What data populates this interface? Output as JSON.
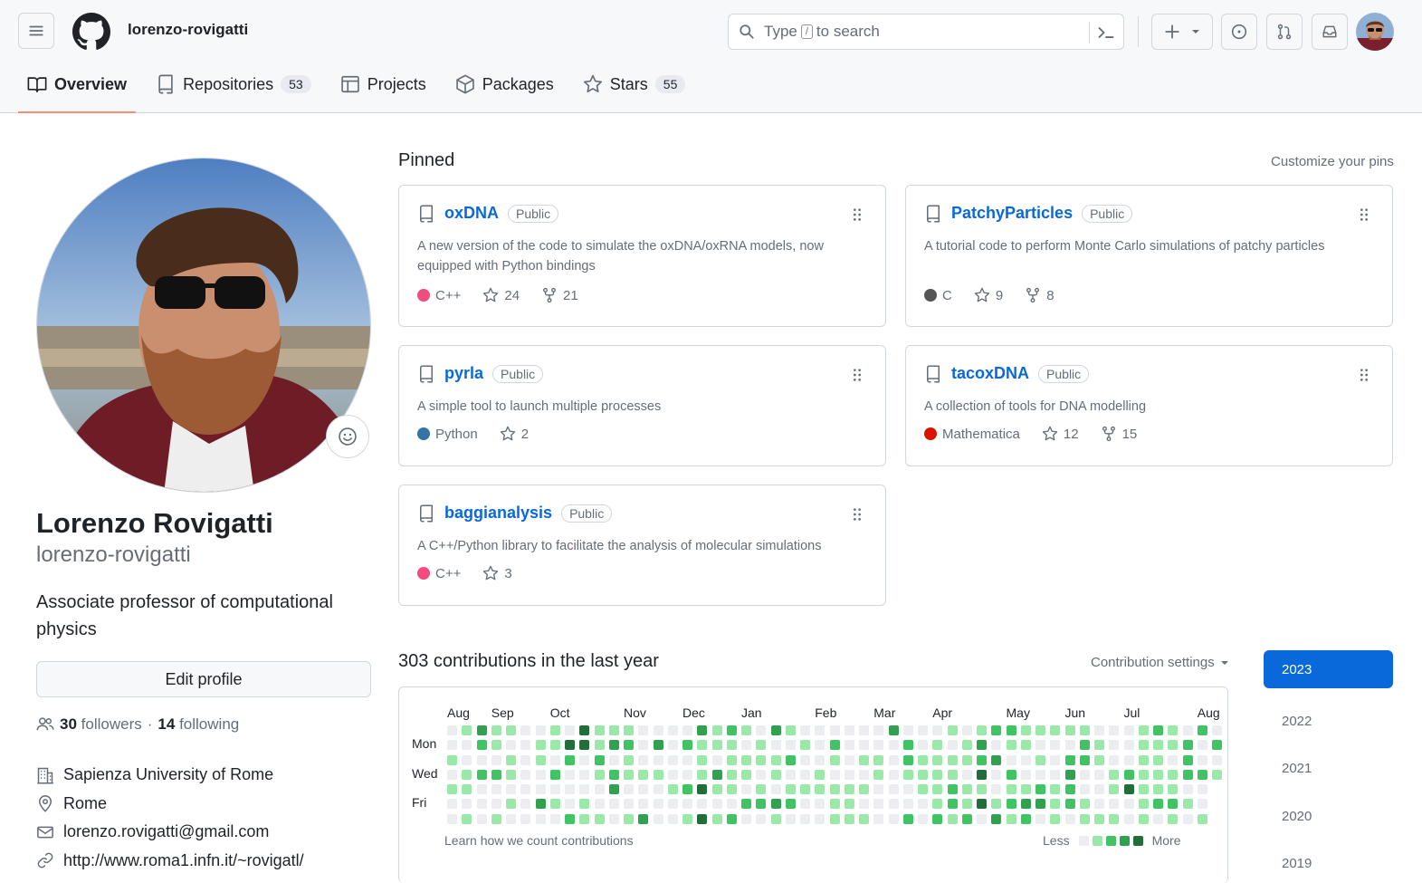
{
  "header": {
    "username": "lorenzo-rovigatti",
    "search_type": "Type",
    "search_key": "/",
    "search_rest": "to search"
  },
  "tabs": [
    {
      "label": "Overview",
      "icon": "book-icon"
    },
    {
      "label": "Repositories",
      "count": "53",
      "icon": "repo-icon"
    },
    {
      "label": "Projects",
      "icon": "table-icon"
    },
    {
      "label": "Packages",
      "icon": "package-icon"
    },
    {
      "label": "Stars",
      "count": "55",
      "icon": "star-icon"
    }
  ],
  "profile": {
    "name": "Lorenzo Rovigatti",
    "login": "lorenzo-rovigatti",
    "bio": "Associate professor of computational physics",
    "edit_label": "Edit profile",
    "followers_count": "30",
    "followers_label": "followers",
    "sep": "·",
    "following_count": "14",
    "following_label": "following",
    "organization": "Sapienza University of Rome",
    "location": "Rome",
    "email": "lorenzo.rovigatti@gmail.com",
    "website": "http://www.roma1.infn.it/~rovigatl/"
  },
  "pinned": {
    "title": "Pinned",
    "customize": "Customize your pins",
    "repos": [
      {
        "name": "oxDNA",
        "visibility": "Public",
        "description": "A new version of the code to simulate the oxDNA/oxRNA models, now equipped with Python bindings",
        "language": "C++",
        "lang_color": "#f34b7d",
        "stars": "24",
        "forks": "21"
      },
      {
        "name": "PatchyParticles",
        "visibility": "Public",
        "description": "A tutorial code to perform Monte Carlo simulations of patchy particles",
        "language": "C",
        "lang_color": "#555555",
        "stars": "9",
        "forks": "8"
      },
      {
        "name": "pyrla",
        "visibility": "Public",
        "description": "A simple tool to launch multiple processes",
        "language": "Python",
        "lang_color": "#3572A5",
        "stars": "2"
      },
      {
        "name": "tacoxDNA",
        "visibility": "Public",
        "description": "A collection of tools for DNA modelling",
        "language": "Mathematica",
        "lang_color": "#dd1100",
        "stars": "12",
        "forks": "15"
      },
      {
        "name": "baggianalysis",
        "visibility": "Public",
        "description": "A C++/Python library to facilitate the analysis of molecular simulations",
        "language": "C++",
        "lang_color": "#f34b7d",
        "stars": "3"
      }
    ]
  },
  "contributions": {
    "title": "303 contributions in the last year",
    "settings": "Contribution settings",
    "months": [
      "Aug",
      "Sep",
      "Oct",
      "Nov",
      "Dec",
      "Jan",
      "Feb",
      "Mar",
      "Apr",
      "May",
      "Jun",
      "Jul",
      "Aug"
    ],
    "days": [
      "Mon",
      "Wed",
      "Fri"
    ],
    "learn": "Learn how we count contributions",
    "less": "Less",
    "more": "More",
    "level_colors": [
      "#ebedf0",
      "#9be9a8",
      "#40c463",
      "#30a14e",
      "#216e39"
    ],
    "years": [
      "2023",
      "2022",
      "2021",
      "2020",
      "2019"
    ]
  }
}
